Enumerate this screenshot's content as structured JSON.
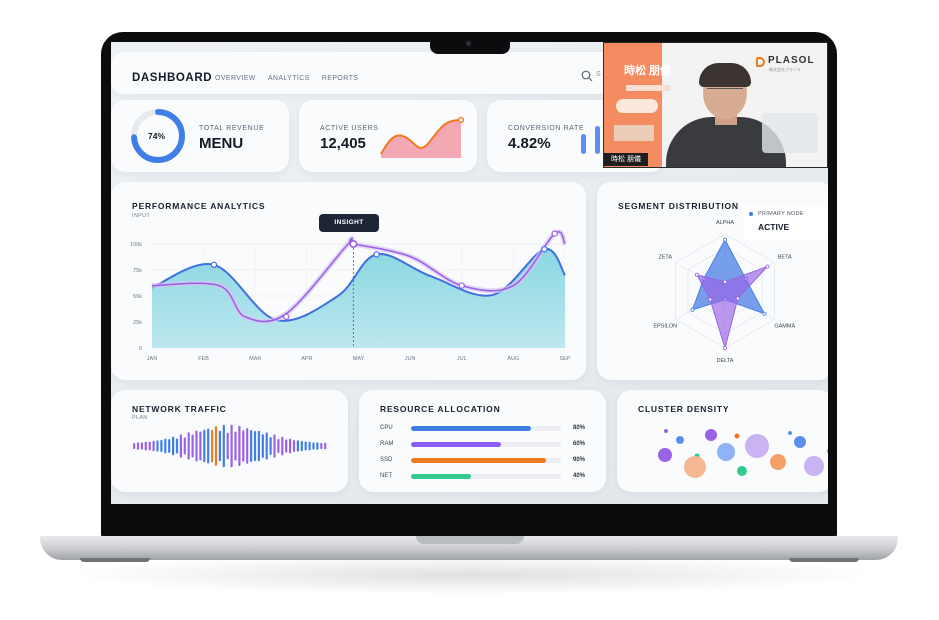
{
  "header": {
    "title": "DASHBOARD",
    "nav": [
      {
        "label": "OVERVIEW"
      },
      {
        "label": "ANALYTICS"
      },
      {
        "label": "REPORTS"
      }
    ],
    "search_placeholder": "S"
  },
  "kpi": {
    "revenue": {
      "kicker": "TOTAL REVENUE",
      "value": "MENU",
      "percent_label": "74%",
      "percent": 74
    },
    "users": {
      "kicker": "ACTIVE USERS",
      "value": "12,405"
    },
    "conversion": {
      "kicker": "CONVERSION RATE",
      "value": "4.82%"
    }
  },
  "performance": {
    "title": "PERFORMANCE ANALYTICS",
    "subtitle": "INPUT",
    "tooltip": "INSIGHT"
  },
  "segment": {
    "title": "SEGMENT DISTRIBUTION",
    "legend_label": "PRIMARY NODE",
    "legend_value": "ACTIVE"
  },
  "network": {
    "title": "NETWORK TRAFFIC",
    "subtitle": "PLAN"
  },
  "resource": {
    "title": "RESOURCE ALLOCATION",
    "items": [
      {
        "label": "CPU",
        "pct_label": "80%",
        "value": 80,
        "color": "#3f7fe6"
      },
      {
        "label": "RAM",
        "pct_label": "60%",
        "value": 60,
        "color": "#8b5cf6"
      },
      {
        "label": "SSD",
        "pct_label": "90%",
        "value": 90,
        "color": "#f07a22"
      },
      {
        "label": "NET",
        "pct_label": "40%",
        "value": 40,
        "color": "#34c98e"
      }
    ]
  },
  "cluster": {
    "title": "CLUSTER DENSITY"
  },
  "video_overlay": {
    "brand": "PLASOL",
    "brand_sub": "株式会社プラソル",
    "speaker": "時松 朋儀",
    "speaker_caption": "時松 朋儀"
  },
  "chart_data": [
    {
      "type": "area",
      "title": "PERFORMANCE ANALYTICS",
      "categories": [
        "JAN",
        "FEB",
        "MAR",
        "APR",
        "MAY",
        "JUN",
        "JUL",
        "AUG",
        "SEP"
      ],
      "y_ticks": [
        "0",
        "25k",
        "50k",
        "75k",
        "100k"
      ],
      "ylim": [
        0,
        100
      ],
      "series": [
        {
          "x": [
            0,
            1.2,
            2.4,
            3.6,
            4.35,
            5.4,
            6.6,
            7.6,
            8.0
          ],
          "values": [
            58,
            80,
            27,
            50,
            90,
            69,
            51,
            95,
            70
          ],
          "color": "#3f6fe0"
        },
        {
          "x": [
            0,
            1.3,
            1.8,
            2.6,
            3.8,
            3.9,
            5.0,
            6.0,
            7.0,
            7.8,
            8.0
          ],
          "values": [
            60,
            60,
            30,
            33,
            100,
            100,
            88,
            60,
            60,
            110,
            100
          ],
          "color": "#9a63e6"
        }
      ]
    },
    {
      "type": "radar",
      "title": "SEGMENT DISTRIBUTION",
      "axes": [
        "ALPHA",
        "BETA",
        "GAMMA",
        "DELTA",
        "EPSILON",
        "ZETA"
      ],
      "series": [
        {
          "values": [
            90,
            42,
            80,
            15,
            66,
            43
          ],
          "color": "#4a7fe6"
        },
        {
          "values": [
            16,
            86,
            26,
            100,
            30,
            57
          ],
          "color": "#9a63e6"
        }
      ]
    },
    {
      "type": "bar",
      "title": "RESOURCE ALLOCATION",
      "categories": [
        "CPU",
        "RAM",
        "SSD",
        "NET"
      ],
      "values": [
        80,
        60,
        90,
        40
      ]
    }
  ]
}
